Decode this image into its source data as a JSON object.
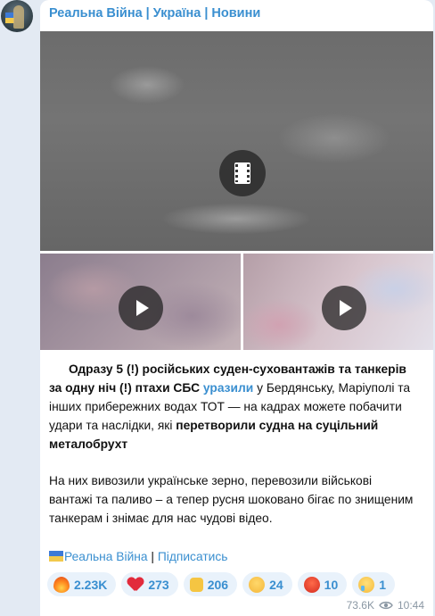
{
  "channel": {
    "name": "Реальна Війна | Україна | Новини"
  },
  "post": {
    "p1": [
      {
        "t": "Одразу 5 (!) російських суден-суховантажів та танкерів за одну ніч (!) птахи СБС ",
        "s": "bold"
      },
      {
        "t": "уразили",
        "s": "link"
      },
      {
        "t": " у Бердянську, Маріуполі та інших прибережних водах ТОТ — на кадрах можете побачити удари та наслідки, які ",
        "s": "plain"
      },
      {
        "t": "перетворили судна на суцільний металобрухт",
        "s": "bold"
      }
    ],
    "p2": "На них вивозили українське зерно, перевозили військові вантажі та паливо – а тепер русня шоковано бігає по знищеним танкерам і знімає для нас чудові відео.",
    "signature": {
      "channel_link": "Реальна Війна",
      "separator": " | ",
      "subscribe_link": "Підписатись"
    }
  },
  "reactions": [
    {
      "icon": "fire-icon",
      "count": "2.23K"
    },
    {
      "icon": "heart-icon",
      "count": "273"
    },
    {
      "icon": "thumbs-up-icon",
      "count": "206"
    },
    {
      "icon": "grinning-face-icon",
      "count": "24"
    },
    {
      "icon": "angry-face-icon",
      "count": "10"
    },
    {
      "icon": "crying-face-icon",
      "count": "1"
    }
  ],
  "meta": {
    "views": "73.6K",
    "time": "10:44"
  },
  "colors": {
    "accent": "#3a8fd0",
    "background": "#e3eaf3",
    "bubble": "#ffffff",
    "reaction_bg": "#e9f2fb"
  }
}
